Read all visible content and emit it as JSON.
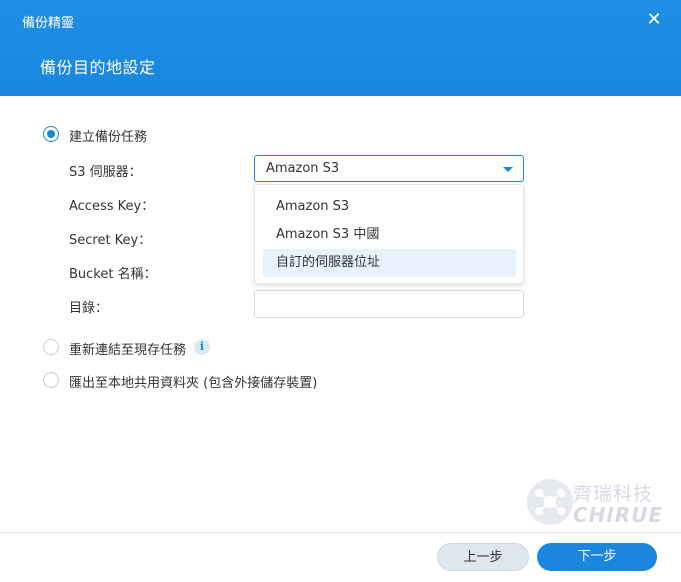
{
  "window": {
    "app_title": "備份精靈",
    "close_glyph": "✕",
    "page_title": "備份目的地設定"
  },
  "options": {
    "create_task": "建立備份任務",
    "relink_task": "重新連結至現存任務",
    "export_local": "匯出至本地共用資料夾 (包含外接儲存裝置)"
  },
  "fields": {
    "s3_server_label": "S3 伺服器：",
    "access_key_label": "Access Key：",
    "secret_key_label": "Secret Key：",
    "bucket_label": "Bucket 名稱：",
    "directory_label": "目錄："
  },
  "s3_select": {
    "selected": "Amazon S3",
    "options": [
      "Amazon S3",
      "Amazon S3 中國",
      "自訂的伺服器位址"
    ],
    "highlighted_index": 2
  },
  "info_glyph": "i",
  "watermark": {
    "cn": "齊瑞科技",
    "en": "CHIRUE"
  },
  "footer": {
    "prev_label": "上一步",
    "next_label": "下一步"
  },
  "colors": {
    "accent": "#1a86de",
    "header_bg": "#1e8fe6",
    "hover_bg": "#e8f2fc"
  },
  "icons": [
    "close-icon",
    "chevron-down-icon",
    "info-icon",
    "radio-checked",
    "radio-unchecked"
  ]
}
